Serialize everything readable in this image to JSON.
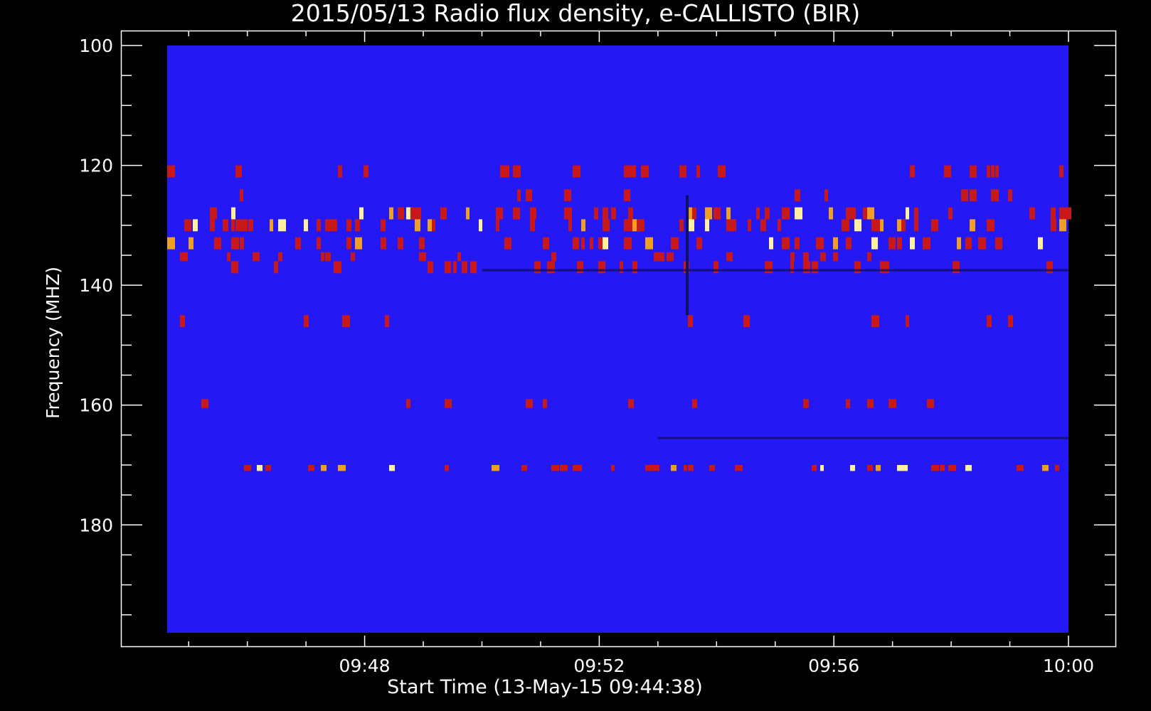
{
  "chart_data": {
    "type": "heatmap",
    "title": "2015/05/13  Radio flux density, e-CALLISTO (BIR)",
    "xlabel": "Start Time (13-May-15 09:44:38)",
    "ylabel": "Frequency (MHZ)",
    "xlim": [
      "09:44:38",
      "10:00:00"
    ],
    "ylim": [
      100,
      198
    ],
    "y_reversed": true,
    "x_ticks": [
      "09:48",
      "09:52",
      "09:56",
      "10:00"
    ],
    "y_ticks": [
      100,
      120,
      140,
      160,
      180
    ],
    "grid": false,
    "legend": "none",
    "colors": {
      "background": "#000000",
      "low": "#2418f5",
      "mid": "#c81818",
      "high": "#fff0a0",
      "dip": "#101060"
    },
    "features": [
      {
        "kind": "interference_band",
        "freq_range": [
          120,
          122
        ],
        "t_start": "09:44:38",
        "t_end": "10:00:00",
        "intensity": "medium"
      },
      {
        "kind": "interference_band",
        "freq_range": [
          124,
          126
        ],
        "t_start": "09:44:38",
        "t_end": "10:00:00",
        "intensity": "low"
      },
      {
        "kind": "interference_band",
        "freq_range": [
          127,
          129
        ],
        "t_start": "09:44:38",
        "t_end": "10:00:00",
        "intensity": "high"
      },
      {
        "kind": "interference_band",
        "freq_range": [
          129,
          131
        ],
        "t_start": "09:44:38",
        "t_end": "10:00:00",
        "intensity": "high"
      },
      {
        "kind": "interference_band",
        "freq_range": [
          132,
          134
        ],
        "t_start": "09:44:38",
        "t_end": "10:00:00",
        "intensity": "high"
      },
      {
        "kind": "interference_band",
        "freq_range": [
          134.5,
          136
        ],
        "t_start": "09:44:38",
        "t_end": "10:00:00",
        "intensity": "medium"
      },
      {
        "kind": "interference_band",
        "freq_range": [
          136,
          138
        ],
        "t_start": "09:44:38",
        "t_end": "10:00:00",
        "intensity": "medium"
      },
      {
        "kind": "interference_band",
        "freq_range": [
          145,
          147
        ],
        "t_start": "09:44:38",
        "t_end": "10:00:00",
        "intensity": "low"
      },
      {
        "kind": "interference_band",
        "freq_range": [
          159,
          160.5
        ],
        "t_start": "09:44:38",
        "t_end": "10:00:00",
        "intensity": "low"
      },
      {
        "kind": "interference_band",
        "freq_range": [
          170,
          171
        ],
        "t_start": "09:44:38",
        "t_end": "10:00:00",
        "intensity": "high"
      },
      {
        "kind": "dark_line",
        "freq": 137.5,
        "t_start": "09:50:00",
        "t_end": "10:00:00"
      },
      {
        "kind": "dark_line",
        "freq": 165.5,
        "t_start": "09:53:00",
        "t_end": "10:00:00"
      },
      {
        "kind": "burst",
        "t": "09:53:30",
        "freq_range": [
          125,
          145
        ]
      }
    ]
  }
}
